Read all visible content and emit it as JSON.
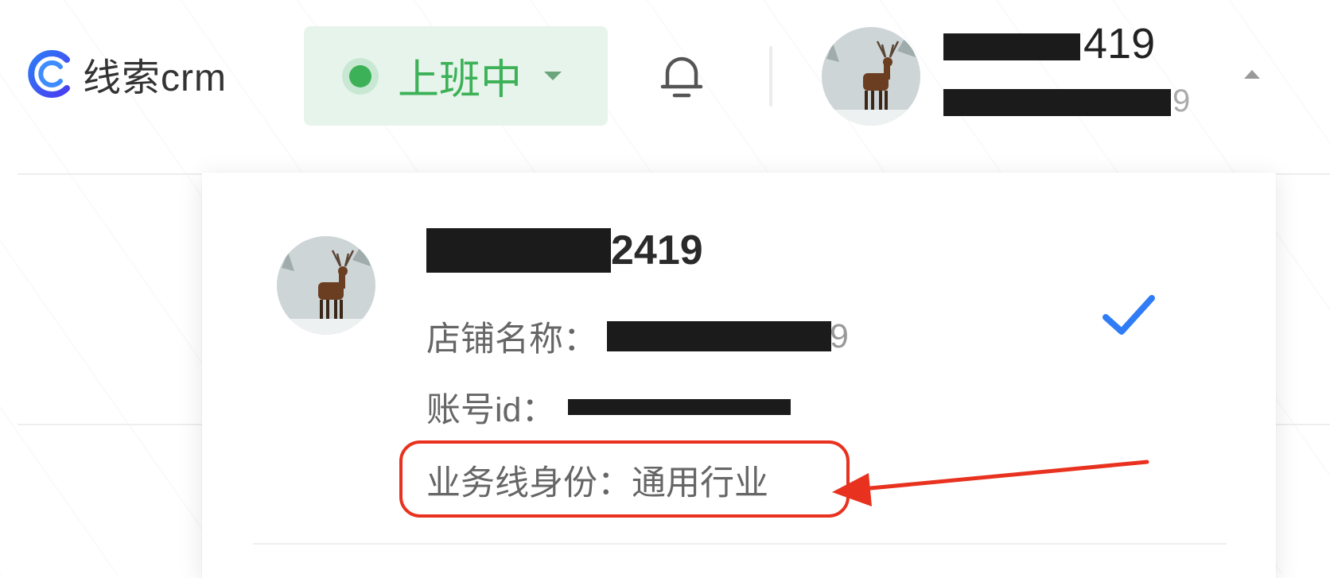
{
  "app": {
    "logo_text": "线索crm"
  },
  "status": {
    "label": "上班中",
    "color": "#3cb157"
  },
  "user": {
    "name_visible_suffix": "419",
    "sub_visible_suffix": "9"
  },
  "profile_card": {
    "name_visible_suffix": "2419",
    "shop_label": "店铺名称：",
    "shop_visible_suffix": "9",
    "account_label": "账号id：",
    "business_label": "业务线身份：",
    "business_value": "通用行业",
    "selected": true
  },
  "annotation": {
    "highlight_color": "#e8321f"
  },
  "icons": {
    "logo": "logo-c-icon",
    "bell": "bell-icon",
    "check": "check-icon",
    "status_caret": "caret-down-icon",
    "user_caret": "caret-up-icon"
  }
}
